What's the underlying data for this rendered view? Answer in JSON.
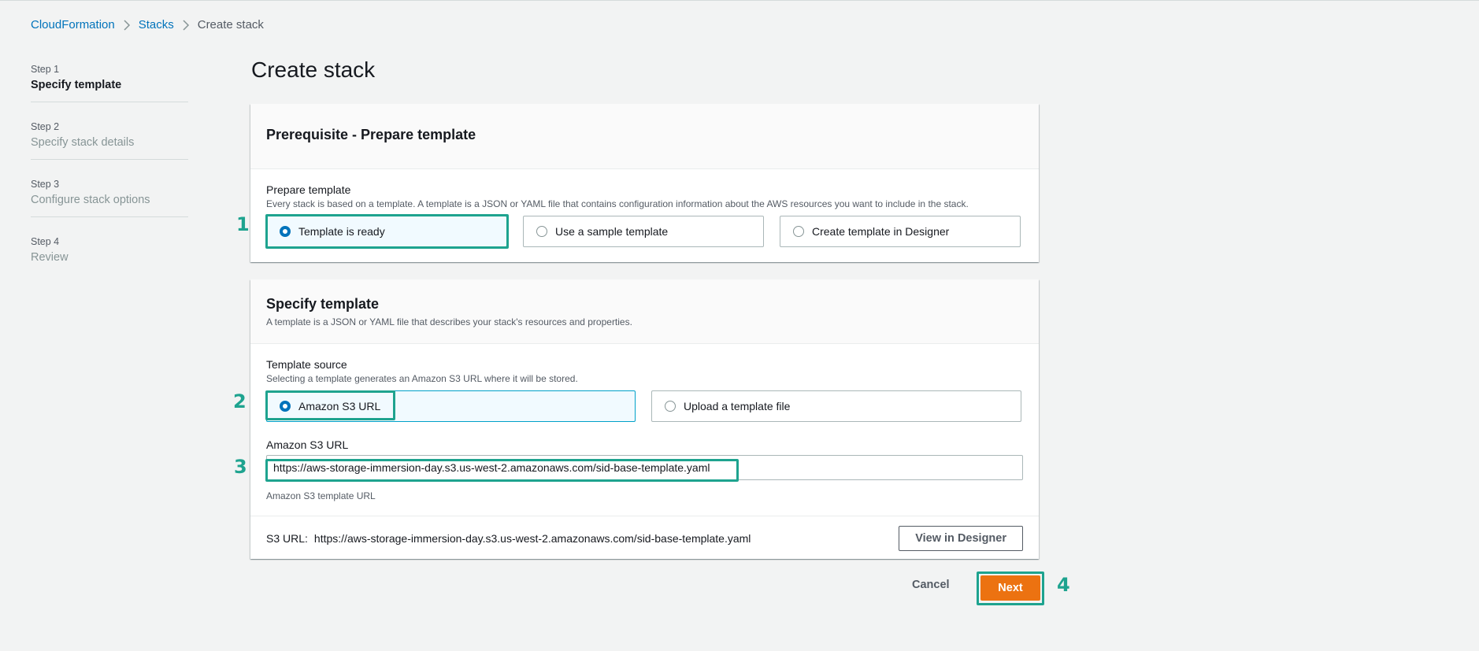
{
  "breadcrumb": {
    "items": [
      "CloudFormation",
      "Stacks"
    ],
    "current": "Create stack"
  },
  "steps": [
    {
      "num": "Step 1",
      "title": "Specify template"
    },
    {
      "num": "Step 2",
      "title": "Specify stack details"
    },
    {
      "num": "Step 3",
      "title": "Configure stack options"
    },
    {
      "num": "Step 4",
      "title": "Review"
    }
  ],
  "page_title": "Create stack",
  "prerequisite": {
    "title": "Prerequisite - Prepare template",
    "label": "Prepare template",
    "description": "Every stack is based on a template. A template is a JSON or YAML file that contains configuration information about the AWS resources you want to include in the stack.",
    "options": [
      "Template is ready",
      "Use a sample template",
      "Create template in Designer"
    ],
    "selected": "Template is ready"
  },
  "specify": {
    "title": "Specify template",
    "subtitle": "A template is a JSON or YAML file that describes your stack's resources and properties.",
    "source_label": "Template source",
    "source_description": "Selecting a template generates an Amazon S3 URL where it will be stored.",
    "options": [
      "Amazon S3 URL",
      "Upload a template file"
    ],
    "selected": "Amazon S3 URL",
    "url_label": "Amazon S3 URL",
    "url_value": "https://aws-storage-immersion-day.s3.us-west-2.amazonaws.com/sid-base-template.yaml",
    "url_hint": "Amazon S3 template URL",
    "s3_url_label": "S3 URL:",
    "s3_url_value": "https://aws-storage-immersion-day.s3.us-west-2.amazonaws.com/sid-base-template.yaml",
    "view_designer": "View in Designer"
  },
  "actions": {
    "cancel": "Cancel",
    "next": "Next"
  },
  "annotations": [
    "1",
    "2",
    "3",
    "4"
  ],
  "colors": {
    "primary": "#ec7211",
    "link": "#0073bb",
    "annotation": "#1ea38f"
  }
}
